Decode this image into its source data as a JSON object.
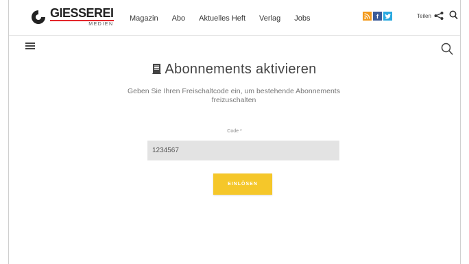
{
  "header": {
    "logo_text": "GIESSEREI",
    "logo_sub": "MEDIEN",
    "nav": [
      "Magazin",
      "Abo",
      "Aktuelles Heft",
      "Verlag",
      "Jobs"
    ],
    "social": [
      {
        "name": "rss-icon",
        "glyph": "⌘",
        "color": "#f39a1c"
      },
      {
        "name": "facebook-icon",
        "glyph": "f",
        "color": "#3b5b98"
      },
      {
        "name": "twitter-icon",
        "glyph": "t",
        "color": "#2aa9e0"
      }
    ],
    "share_label": "Teilen"
  },
  "main": {
    "title": "Abonnements aktivieren",
    "subtitle": "Geben Sie Ihren Freischaltcode ein, um bestehende Abonnements freizuschalten",
    "code_label": "Code *",
    "code_value": "1234567",
    "submit_label": "EINLÖSEN"
  },
  "colors": {
    "accent": "#f5c72a",
    "logo_red": "#e3262b",
    "input_bg": "#e3e3e3"
  }
}
